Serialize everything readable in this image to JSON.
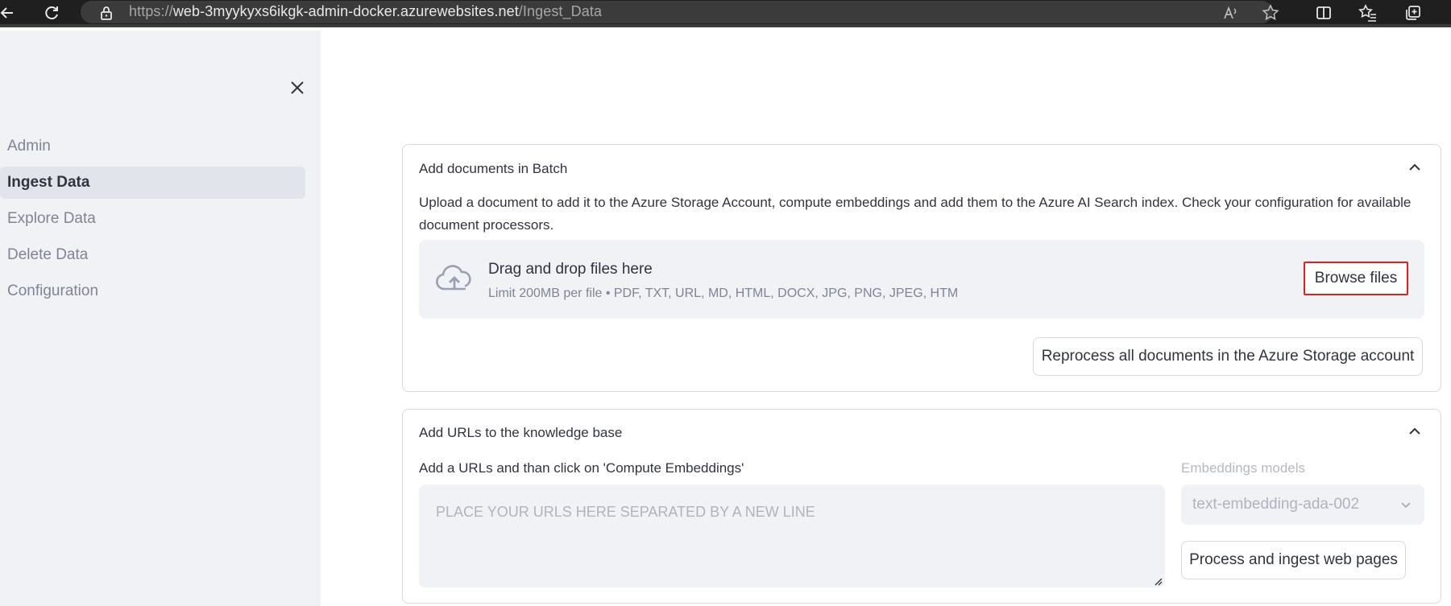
{
  "browser": {
    "url_scheme": "https://",
    "url_host": "web-3myykyxs6ikgk-admin-docker.azurewebsites.net",
    "url_path": "/Ingest_Data"
  },
  "sidebar": {
    "items": [
      {
        "label": "Admin",
        "active": false
      },
      {
        "label": "Ingest Data",
        "active": true
      },
      {
        "label": "Explore Data",
        "active": false
      },
      {
        "label": "Delete Data",
        "active": false
      },
      {
        "label": "Configuration",
        "active": false
      }
    ]
  },
  "batch": {
    "title": "Add documents in Batch",
    "description": "Upload a document to add it to the Azure Storage Account, compute embeddings and add them to the Azure AI Search index. Check your configuration for available document processors.",
    "dropzone_title": "Drag and drop files here",
    "dropzone_limit": "Limit 200MB per file • PDF, TXT, URL, MD, HTML, DOCX, JPG, PNG, JPEG, HTM",
    "browse_label": "Browse files",
    "reprocess_label": "Reprocess all documents in the Azure Storage account"
  },
  "urls": {
    "title": "Add URLs to the knowledge base",
    "input_label": "Add a URLs and than click on 'Compute Embeddings'",
    "input_placeholder": "PLACE YOUR URLS HERE SEPARATED BY A NEW LINE",
    "model_label": "Embeddings models",
    "model_value": "text-embedding-ada-002",
    "process_label": "Process and ingest web pages"
  },
  "colors": {
    "highlight": "#e0201a",
    "sidebar_bg": "#f0f2f6",
    "text": "#31333f",
    "muted": "#808495"
  }
}
